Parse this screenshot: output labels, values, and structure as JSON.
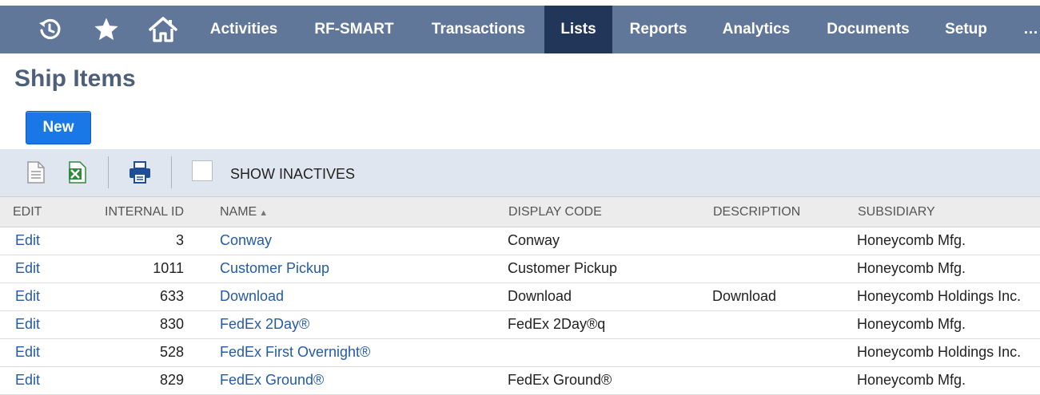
{
  "nav": {
    "items": [
      "Activities",
      "RF-SMART",
      "Transactions",
      "Lists",
      "Reports",
      "Analytics",
      "Documents",
      "Setup",
      "…"
    ],
    "active": "Lists",
    "icons": [
      "recent-history-icon",
      "star-icon",
      "home-icon"
    ]
  },
  "page": {
    "title": "Ship Items",
    "new_label": "New"
  },
  "toolbar": {
    "show_inactives_label": "SHOW INACTIVES",
    "show_inactives_checked": false
  },
  "table": {
    "headers": {
      "edit": "EDIT",
      "internal_id": "INTERNAL ID",
      "name": "NAME",
      "display_code": "DISPLAY CODE",
      "description": "DESCRIPTION",
      "subsidiary": "SUBSIDIARY"
    },
    "rows": [
      {
        "edit": "Edit",
        "internal_id": "3",
        "name": "Conway",
        "display_code": "Conway",
        "description": "",
        "subsidiary": "Honeycomb Mfg."
      },
      {
        "edit": "Edit",
        "internal_id": "1011",
        "name": "Customer Pickup",
        "display_code": "Customer Pickup",
        "description": "",
        "subsidiary": "Honeycomb Mfg."
      },
      {
        "edit": "Edit",
        "internal_id": "633",
        "name": "Download",
        "display_code": "Download",
        "description": "Download",
        "subsidiary": "Honeycomb Holdings Inc."
      },
      {
        "edit": "Edit",
        "internal_id": "830",
        "name": "FedEx 2Day®",
        "display_code": "FedEx 2Day®q",
        "description": "",
        "subsidiary": "Honeycomb Mfg."
      },
      {
        "edit": "Edit",
        "internal_id": "528",
        "name": "FedEx First Overnight®",
        "display_code": "",
        "description": "",
        "subsidiary": "Honeycomb Holdings Inc."
      },
      {
        "edit": "Edit",
        "internal_id": "829",
        "name": "FedEx Ground®",
        "display_code": "FedEx Ground®",
        "description": "",
        "subsidiary": "Honeycomb Mfg."
      }
    ]
  }
}
